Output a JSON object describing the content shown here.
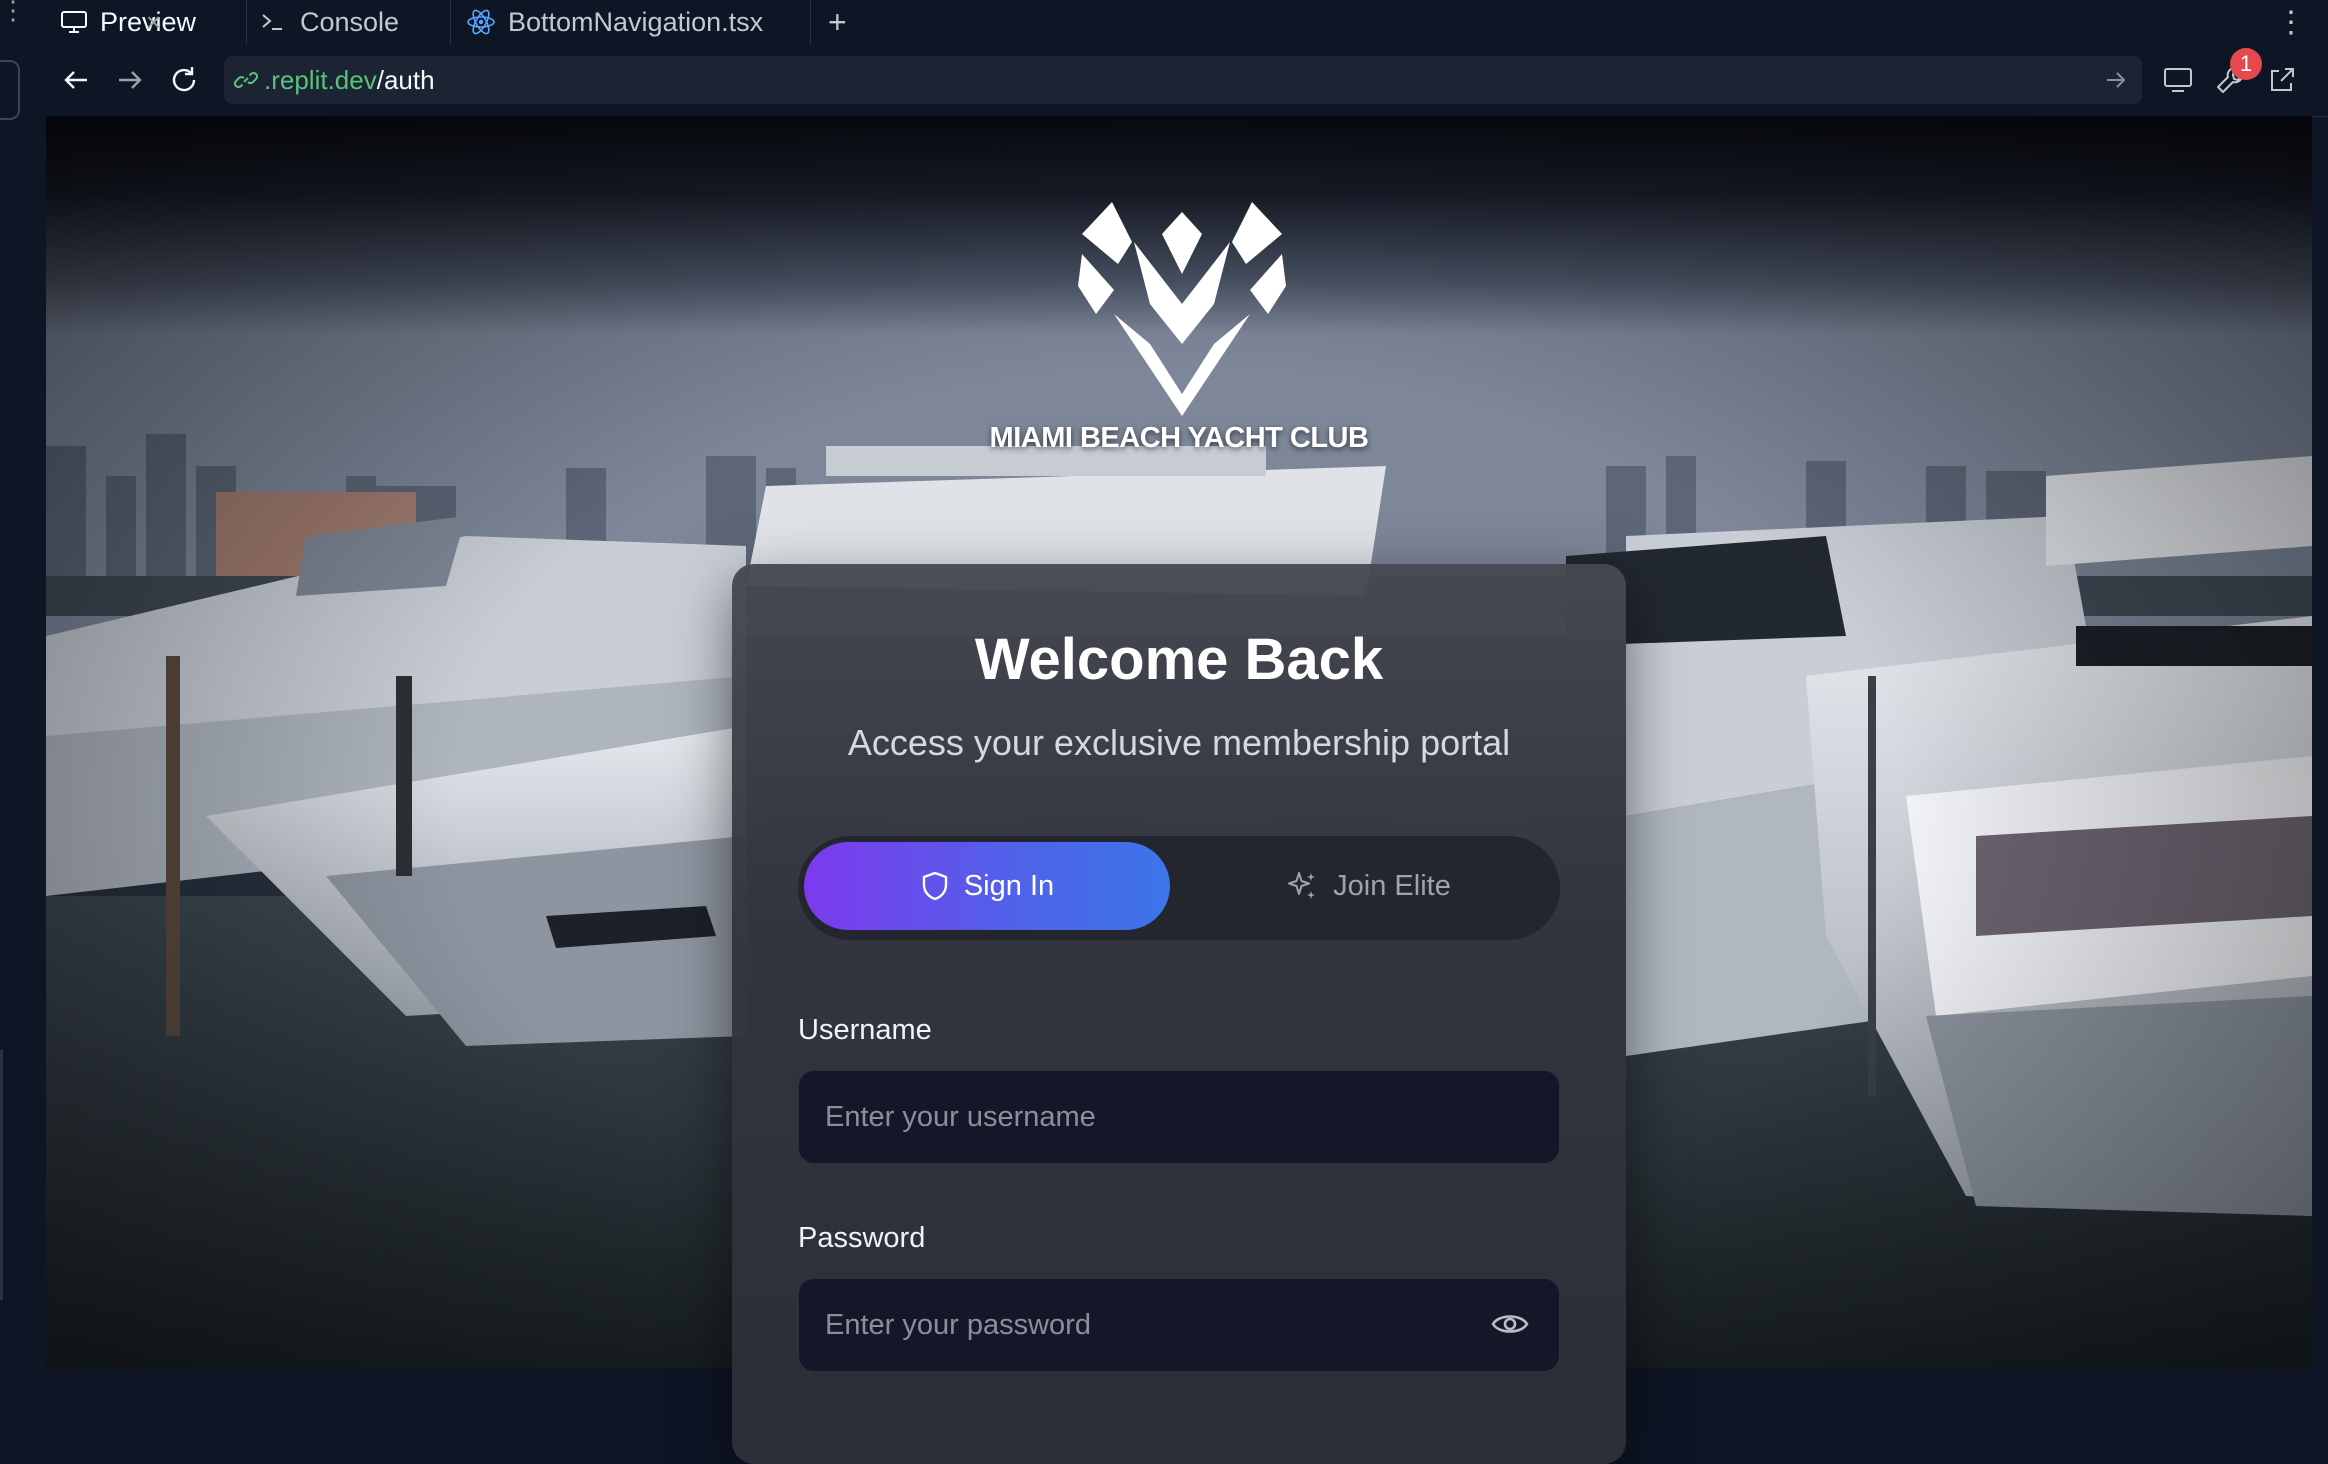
{
  "tabs": [
    {
      "label": "Preview",
      "icon": "monitor-icon",
      "active": true
    },
    {
      "label": "Console",
      "icon": "terminal-icon",
      "active": false
    },
    {
      "label": "BottomNavigation.tsx",
      "icon": "react-icon",
      "active": false
    }
  ],
  "navbar": {
    "url_domain": ".replit.dev",
    "url_path": "/auth",
    "notification_count": "1"
  },
  "page": {
    "club_name": "MIAMI BEACH YACHT CLUB",
    "title": "Welcome Back",
    "subtitle": "Access your exclusive membership portal",
    "segments": {
      "signin": "Sign In",
      "join": "Join Elite"
    },
    "form": {
      "username_label": "Username",
      "username_placeholder": "Enter your username",
      "password_label": "Password",
      "password_placeholder": "Enter your password"
    }
  },
  "colors": {
    "ide_bg": "#0e1525",
    "url_domain": "#58c27d",
    "signin_gradient_start": "#7c3aed",
    "signin_gradient_end": "#3b76e8",
    "badge": "#e5484d"
  }
}
